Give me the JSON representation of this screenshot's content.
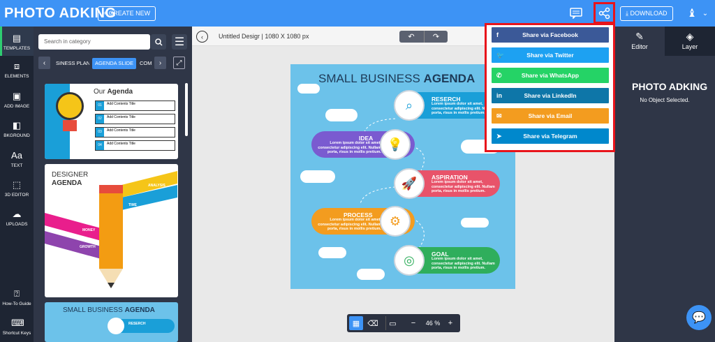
{
  "app": {
    "logo": "PHOTO ADKING",
    "create_label": "+ CREATE NEW",
    "download_label": "DOWNLOAD"
  },
  "leftbar": {
    "items": [
      {
        "label": "TEMPLATES",
        "icon": "templates-icon"
      },
      {
        "label": "ELEMENTS",
        "icon": "elements-icon"
      },
      {
        "label": "ADD IMAGE",
        "icon": "image-icon"
      },
      {
        "label": "BKGROUND",
        "icon": "background-icon"
      },
      {
        "label": "TEXT",
        "icon": "text-icon"
      },
      {
        "label": "3D EDITOR",
        "icon": "cube-icon"
      },
      {
        "label": "UPLOADS",
        "icon": "upload-icon"
      },
      {
        "label": "How-To Guide",
        "icon": "guide-icon"
      },
      {
        "label": "Shortcut Keys",
        "icon": "keyboard-icon"
      }
    ]
  },
  "panel": {
    "search_placeholder": "Search in category",
    "categories": [
      "SINESS PLAN",
      "AGENDA SLIDE",
      "COM"
    ],
    "thumbs": [
      {
        "title_a": "Our ",
        "title_b": "Agenda",
        "rows": [
          "Add Contents Title",
          "Add Contents Title",
          "Add Contents Title",
          "Add Contents Title"
        ],
        "nums": [
          "01",
          "02",
          "03",
          "04"
        ]
      },
      {
        "title_a": "DESIGNER",
        "title_b": "AGENDA",
        "labels": [
          "ANALYSIS",
          "TIME",
          "MONEY",
          "GROWTH"
        ]
      },
      {
        "title_a": "SMALL BUSINESS ",
        "title_b": "AGENDA",
        "first": "RESERCH"
      }
    ]
  },
  "workspace": {
    "doc_title": "Untitled Desigr",
    "doc_size": "| 1080 X 1080 px",
    "zoom": "46 %"
  },
  "canvas": {
    "title_a": "SMALL BUSINESS ",
    "title_b": "AGENDA",
    "body": "Lorem ipsum dolor sit amet, consectetur adipiscing elit. Nullam porta, risus in mollis pretium.",
    "steps": [
      {
        "title": "RESERCH",
        "color": "#1a9fd8",
        "icon": "magnifier-icon"
      },
      {
        "title": "IDEA",
        "color": "#7a5bd0",
        "icon": "bulb-icon"
      },
      {
        "title": "ASPIRATION",
        "color": "#e8536a",
        "icon": "rocket-icon"
      },
      {
        "title": "PROCESS",
        "color": "#f39c1f",
        "icon": "gear-icon"
      },
      {
        "title": "GOAL",
        "color": "#2fae5c",
        "icon": "target-icon"
      }
    ]
  },
  "share": {
    "items": [
      {
        "label": "Share via Facebook",
        "icon": "f",
        "color": "#3b5998"
      },
      {
        "label": "Share via Twitter",
        "icon": "🐦",
        "color": "#1da1f2"
      },
      {
        "label": "Share via WhatsApp",
        "icon": "✆",
        "color": "#25d366"
      },
      {
        "label": "Share via LinkedIn",
        "icon": "in",
        "color": "#0e76a8"
      },
      {
        "label": "Share via Email",
        "icon": "✉",
        "color": "#f39c1f"
      },
      {
        "label": "Share via Telegram",
        "icon": "➤",
        "color": "#0088cc"
      }
    ]
  },
  "rightbar": {
    "tab_editor": "Editor",
    "tab_layer": "Layer",
    "logo": "PHOTO ADKING",
    "message": "No Object Selected."
  }
}
